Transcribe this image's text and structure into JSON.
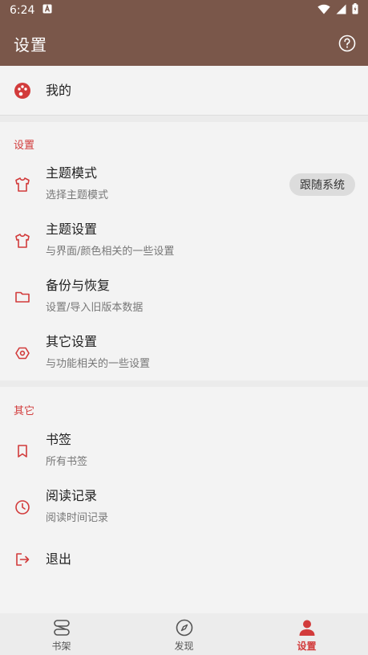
{
  "status_bar": {
    "time": "6:24"
  },
  "app_bar": {
    "title": "设置"
  },
  "mine": {
    "label": "我的"
  },
  "settings_section": {
    "label": "设置",
    "items": [
      {
        "title": "主题模式",
        "subtitle": "选择主题模式",
        "value": "跟随系统",
        "icon": "shirt-icon"
      },
      {
        "title": "主题设置",
        "subtitle": "与界面/颜色相关的一些设置",
        "icon": "shirt-icon"
      },
      {
        "title": "备份与恢复",
        "subtitle": "设置/导入旧版本数据",
        "icon": "folder-icon"
      },
      {
        "title": "其它设置",
        "subtitle": "与功能相关的一些设置",
        "icon": "hexagon-icon"
      }
    ]
  },
  "other_section": {
    "label": "其它",
    "items": [
      {
        "title": "书签",
        "subtitle": "所有书签",
        "icon": "bookmark-icon"
      },
      {
        "title": "阅读记录",
        "subtitle": "阅读时间记录",
        "icon": "clock-icon"
      },
      {
        "title": "退出",
        "icon": "logout-icon"
      }
    ]
  },
  "bottom_nav": {
    "items": [
      {
        "label": "书架",
        "icon": "bookshelf-icon"
      },
      {
        "label": "发现",
        "icon": "compass-icon"
      },
      {
        "label": "设置",
        "icon": "person-icon",
        "active": true
      }
    ]
  },
  "colors": {
    "primary": "#7a574a",
    "accent": "#d23b3b",
    "background": "#f3f3f3"
  }
}
